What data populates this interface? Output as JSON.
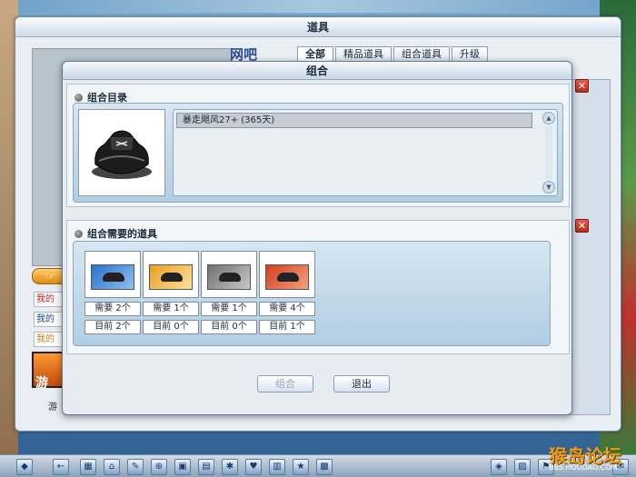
{
  "outer_window": {
    "title": "道具",
    "logo_text": "网吧",
    "tabs": [
      "全部",
      "精品道具",
      "组合道具",
      "升级"
    ],
    "side_pointer": "☞",
    "side_links": [
      "我的",
      "我的",
      "我的"
    ],
    "game_icon_label": "游",
    "game_caption": "游"
  },
  "combo_dialog": {
    "title": "组合",
    "section_catalog": {
      "heading": "组合目录",
      "list_items": [
        "暴走飓风27+ (365天)"
      ]
    },
    "section_required": {
      "heading": "组合需要的道具",
      "items": [
        {
          "color": "#2a6fc8",
          "need": "需要 2个",
          "current": "目前 2个"
        },
        {
          "color": "#e8a020",
          "need": "需要 1个",
          "current": "目前 0个"
        },
        {
          "color": "#707070",
          "need": "需要 1个",
          "current": "目前 0个"
        },
        {
          "color": "#d04020",
          "need": "需要 4个",
          "current": "目前 1个"
        }
      ]
    },
    "buttons": {
      "combine": "组合",
      "exit": "退出"
    }
  },
  "taskbar_icons": [
    "◆",
    "←",
    "▦",
    "⌂",
    "✎",
    "⊕",
    "▣",
    "▤",
    "✱",
    "♥",
    "▥",
    "★",
    "▩",
    "◈",
    "▨",
    "⚑",
    "✉"
  ],
  "forum": {
    "logo": "猴岛论坛",
    "url": "BBS.HOUDAO.COM"
  },
  "colors": {
    "accent": "#5f7d9a",
    "close_red": "#d03a2a"
  }
}
